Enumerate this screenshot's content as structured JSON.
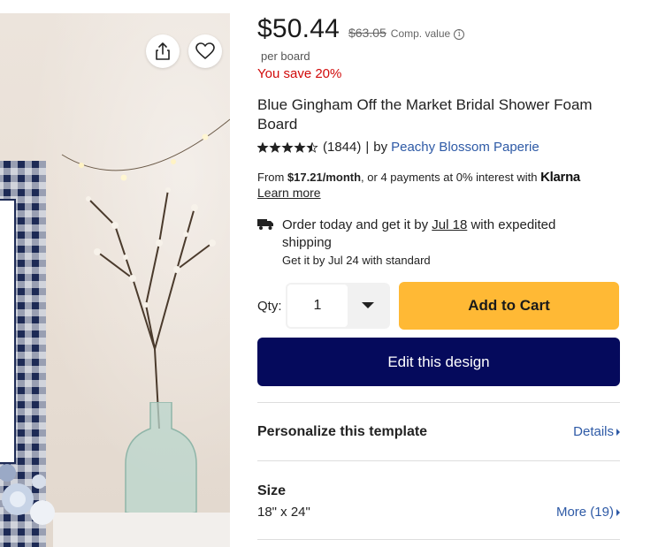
{
  "product_image": {
    "share_icon": "share-icon",
    "favorite_icon": "heart-icon"
  },
  "pricing": {
    "price": "$50.44",
    "comp_price": "$63.05",
    "comp_label": "Comp. value",
    "info_icon": "i",
    "per_unit": "per board",
    "savings": "You save 20%"
  },
  "product": {
    "title": "Blue Gingham Off the Market Bridal Shower Foam Board",
    "rating": 4.5,
    "rating_count": "(1844)",
    "separator": "|",
    "by_label": "by",
    "seller": "Peachy Blossom Paperie"
  },
  "financing": {
    "prefix": "From ",
    "monthly": "$17.21/month",
    "suffix": ", or 4 payments at 0% interest with ",
    "provider": "Klarna",
    "learn_more": "Learn more"
  },
  "shipping": {
    "line_prefix": "Order today and get it by ",
    "date": "Jul 18",
    "line_suffix": " with expedited shipping",
    "standard": "Get it by Jul 24 with standard"
  },
  "purchase": {
    "qty_label": "Qty:",
    "qty_value": "1",
    "add_to_cart": "Add to Cart",
    "edit_design": "Edit this design"
  },
  "personalize": {
    "title": "Personalize this template",
    "link": "Details"
  },
  "size": {
    "title": "Size",
    "value": "18\" x 24\"",
    "link": "More (19)"
  },
  "colors": {
    "price_text": "#1a1a1a",
    "savings": "#d10a0a",
    "link": "#2e5aa6",
    "add_to_cart": "#ffb935",
    "edit_design": "#050a5c"
  }
}
